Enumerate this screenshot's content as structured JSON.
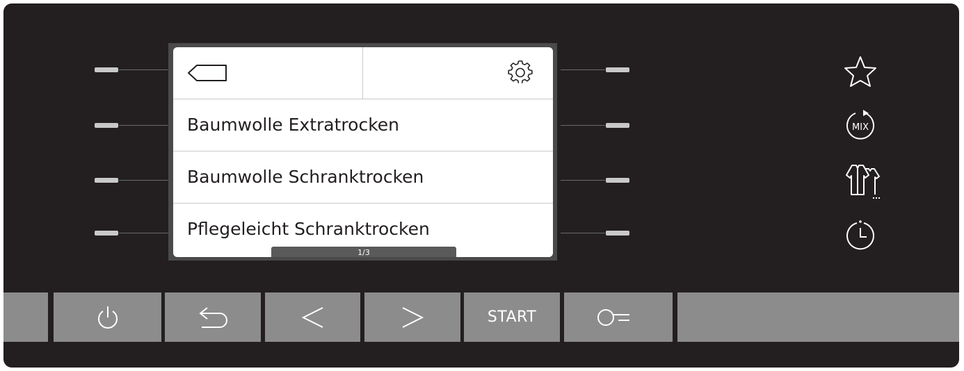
{
  "display": {
    "header": {
      "back_icon": "tag-back-icon",
      "settings_icon": "gear-icon"
    },
    "programs": [
      {
        "label": "Baumwolle Extratrocken"
      },
      {
        "label": "Baumwolle Schranktrocken"
      },
      {
        "label": "Pflegeleicht Schranktrocken"
      }
    ],
    "page_indicator": "1/3"
  },
  "right_icons": [
    {
      "name": "favorite-star-icon"
    },
    {
      "name": "mix-icon",
      "label": "MIX"
    },
    {
      "name": "shirts-icon"
    },
    {
      "name": "timer-icon"
    }
  ],
  "bottom_keys": [
    {
      "name": "power-icon"
    },
    {
      "name": "back-arrow-icon"
    },
    {
      "name": "left-arrow-icon"
    },
    {
      "name": "right-arrow-icon"
    },
    {
      "name": "start-button",
      "label": "START"
    },
    {
      "name": "key-lock-icon"
    }
  ],
  "colors": {
    "panel": "#231f20",
    "key": "#8c8c8c",
    "screen": "#ffffff",
    "side_button": "#c9c9c9"
  }
}
